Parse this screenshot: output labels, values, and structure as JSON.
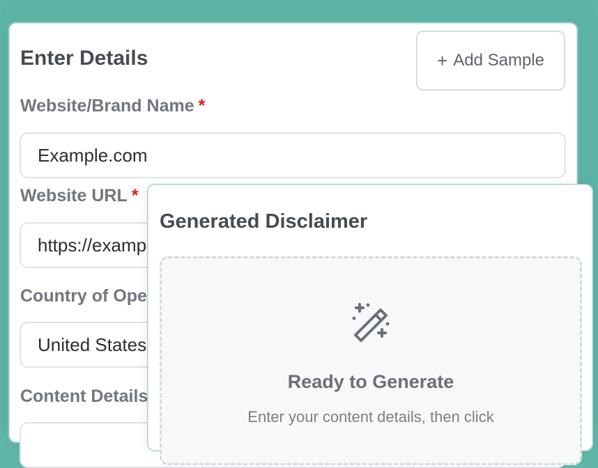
{
  "details": {
    "title": "Enter Details",
    "add_sample_label": "Add Sample",
    "fields": [
      {
        "label": "Website/Brand Name",
        "required_mark": "*",
        "value": "Example.com"
      },
      {
        "label": "Website URL",
        "required_mark": "*",
        "value": "https://example.com"
      },
      {
        "label": "Country of Operation",
        "value": "United States"
      },
      {
        "label": "Content Details",
        "value": ""
      }
    ]
  },
  "generated": {
    "title": "Generated Disclaimer",
    "empty_title": "Ready to Generate",
    "empty_text": "Enter your content details, then click"
  },
  "icons": {
    "add": "plus-icon",
    "wand": "magic-wand-icon"
  },
  "colors": {
    "background": "#5bb3a6",
    "required": "#e01b1b",
    "heading": "#474b52"
  }
}
